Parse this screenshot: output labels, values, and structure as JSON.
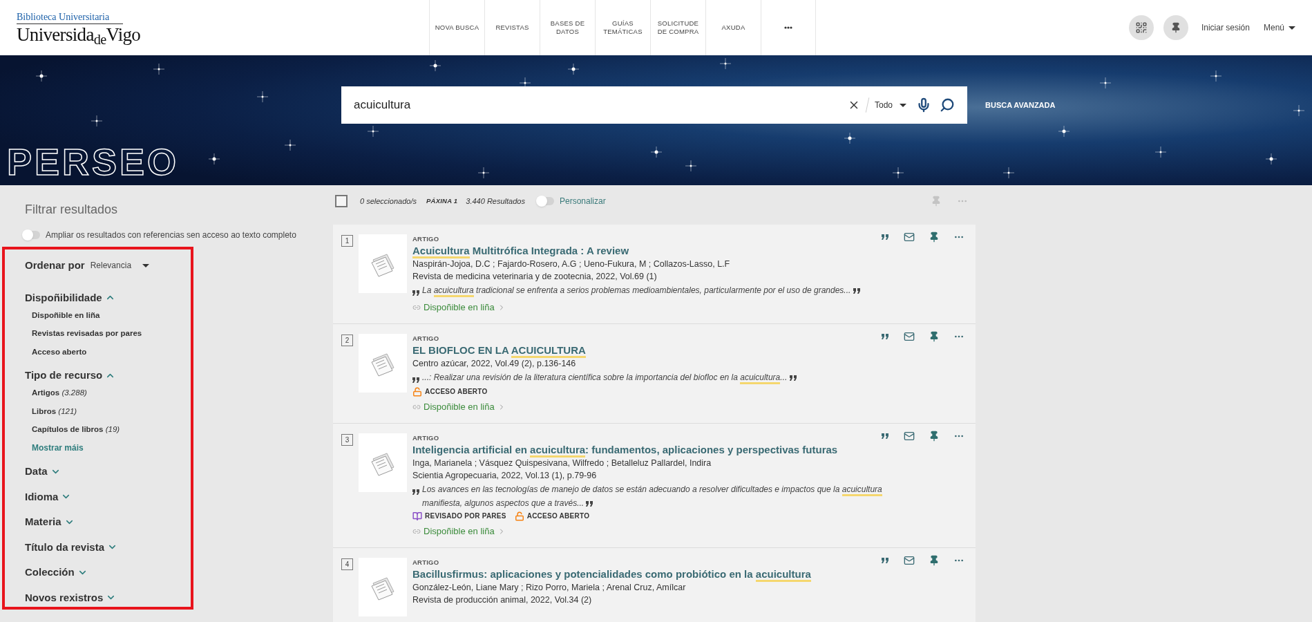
{
  "header": {
    "logo": {
      "line1": "Biblioteca Universitaria",
      "line2": "Universida$_{de}$Vigo"
    },
    "nav": [
      {
        "lines": [
          "NOVA BUSCA"
        ]
      },
      {
        "lines": [
          "REVISTAS"
        ]
      },
      {
        "lines": [
          "BASES DE",
          "DATOS"
        ]
      },
      {
        "lines": [
          "GUÍAS",
          "TEMÁTICAS"
        ]
      },
      {
        "lines": [
          "SOLICITUDE",
          "DE COMPRA"
        ]
      },
      {
        "lines": [
          "AXUDA"
        ]
      }
    ],
    "login": "Iniciar sesión",
    "menu": "Menú"
  },
  "banner": {
    "logo": "PERSEO",
    "search": {
      "value": "acuicultura",
      "scope": "Todo"
    },
    "advanced": "BUSCA AVANZADA"
  },
  "filters": {
    "title": "Filtrar resultados",
    "expand_toggle": {
      "label": "Ampliar os resultados con referencias sen acceso ao texto completo",
      "on": false
    },
    "sort": {
      "label": "Ordenar por",
      "value": "Relevancia"
    },
    "groups": [
      {
        "label": "Dispoñibilidade",
        "expanded": true,
        "options": [
          {
            "label": "Dispoñible en liña"
          },
          {
            "label": "Revistas revisadas por pares"
          },
          {
            "label": "Acceso aberto"
          }
        ]
      },
      {
        "label": "Tipo de recurso",
        "expanded": true,
        "options": [
          {
            "label": "Artigos",
            "count": "(3.288)"
          },
          {
            "label": "Libros",
            "count": "(121)"
          },
          {
            "label": "Capítulos de libros",
            "count": "(19)"
          }
        ],
        "more": "Mostrar máis"
      },
      {
        "label": "Data",
        "expanded": false
      },
      {
        "label": "Idioma",
        "expanded": false
      },
      {
        "label": "Materia",
        "expanded": false
      },
      {
        "label": "Título da revista",
        "expanded": false
      },
      {
        "label": "Colección",
        "expanded": false
      },
      {
        "label": "Novos rexistros",
        "expanded": false
      }
    ]
  },
  "toolbar": {
    "select_all": {
      "checked": false
    },
    "selected": "0 seleccionado/s",
    "page": "PÁXINA 1",
    "results": "3.440 Resultados",
    "personalize": {
      "label": "Personalizar",
      "on": false
    }
  },
  "results": [
    {
      "number": "1",
      "type": "ARTIGO",
      "title": [
        {
          "text": "Acuicultura",
          "highlight": true
        },
        {
          "text": " Multitrófica Integrada : A review",
          "highlight": false
        }
      ],
      "lines": [
        "Naspirán-Jojoa, D.C ; Fajardo-Rosero, A.G ; Ueno-Fukura, M ; Collazos-Lasso, L.F",
        "Revista de medicina veterinaria y de zootecnia, 2022, Vol.69 (1)"
      ],
      "snippet": [
        {
          "text": "La ",
          "highlight": false
        },
        {
          "text": "acuicultura",
          "highlight": true
        },
        {
          "text": " tradicional se enfrenta a serios problemas medioambientales, particularmente por el uso de grandes...",
          "highlight": false
        }
      ],
      "link": "Dispoñible en liña"
    },
    {
      "number": "2",
      "type": "ARTIGO",
      "title": [
        {
          "text": "EL BIOFLOC EN LA ",
          "highlight": false
        },
        {
          "text": "ACUICULTURA",
          "highlight": true
        }
      ],
      "lines": [
        "Centro azúcar, 2022, Vol.49 (2), p.136-146"
      ],
      "snippet": [
        {
          "text": "...: Realizar una revisión de la literatura científica sobre la importancia del biofloc en la ",
          "highlight": false
        },
        {
          "text": "acuicultura",
          "highlight": true
        },
        {
          "text": "...",
          "highlight": false
        }
      ],
      "badges": [
        {
          "kind": "open",
          "label": "ACCESO ABERTO"
        }
      ],
      "link": "Dispoñible en liña"
    },
    {
      "number": "3",
      "type": "ARTIGO",
      "title": [
        {
          "text": "Inteligencia artificial en ",
          "highlight": false
        },
        {
          "text": "acuicultura",
          "highlight": true
        },
        {
          "text": ": fundamentos, aplicaciones y perspectivas futuras",
          "highlight": false
        }
      ],
      "lines": [
        "Inga, Marianela ; Vásquez Quispesivana, Wilfredo ; Betalleluz Pallardel, Indira",
        "Scientia Agropecuaria, 2022, Vol.13 (1), p.79-96"
      ],
      "snippet": [
        {
          "text": "Los avances en las tecnologías de manejo de datos se están adecuando a resolver dificultades e impactos que la ",
          "highlight": false
        },
        {
          "text": "acuicultura",
          "highlight": true
        },
        {
          "text": " manifiesta, algunos aspectos que a través...",
          "highlight": false
        }
      ],
      "badges": [
        {
          "kind": "peer",
          "label": "REVISADO POR PARES"
        },
        {
          "kind": "open",
          "label": "ACCESO ABERTO"
        }
      ],
      "link": "Dispoñible en liña"
    },
    {
      "number": "4",
      "type": "ARTIGO",
      "title": [
        {
          "text": "Bacillusfirmus: aplicaciones y potencialidades como probiótico en la ",
          "highlight": false
        },
        {
          "text": "acuicultura",
          "highlight": true
        }
      ],
      "lines": [
        "González-León, Liane Mary ; Rizo Porro, Mariela ; Arenal Cruz, Amílcar",
        "Revista de producción animal, 2022, Vol.34 (2)"
      ]
    }
  ]
}
